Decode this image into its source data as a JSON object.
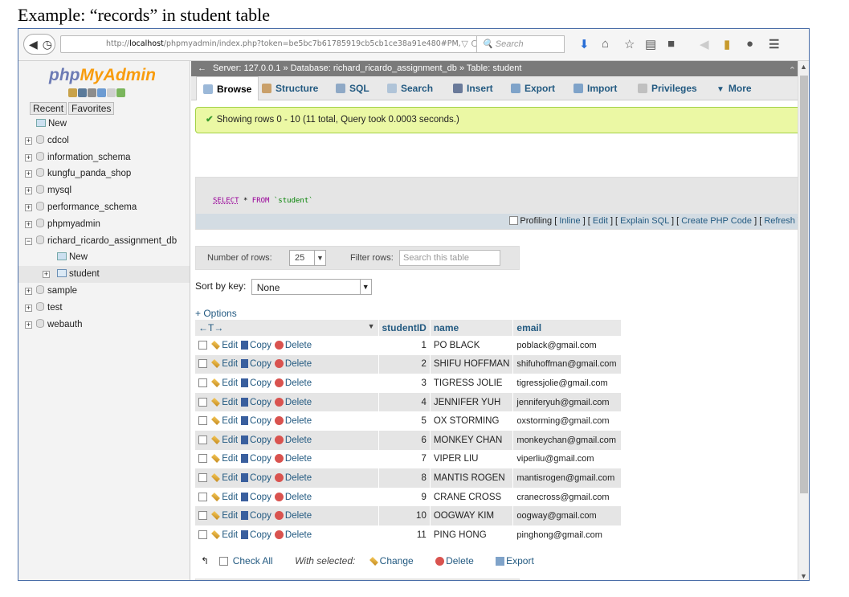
{
  "caption": "Example: “records” in student table",
  "browser": {
    "url_prefix": "http://",
    "url_host": "localhost",
    "url_rest": "/phpmyadmin/index.php?token=be5bc7b61785919cb5cb1ce38a91e480#PM,",
    "url_right": "▽ C",
    "search_placeholder": "Search"
  },
  "sidebar": {
    "logo_php": "php",
    "logo_my": "My",
    "logo_admin": "Admin",
    "tab_recent": "Recent",
    "tab_favorites": "Favorites",
    "tree": [
      {
        "label": "New",
        "type": "new"
      },
      {
        "label": "cdcol",
        "type": "db"
      },
      {
        "label": "information_schema",
        "type": "db"
      },
      {
        "label": "kungfu_panda_shop",
        "type": "db"
      },
      {
        "label": "mysql",
        "type": "db"
      },
      {
        "label": "performance_schema",
        "type": "db"
      },
      {
        "label": "phpmyadmin",
        "type": "db"
      },
      {
        "label": "richard_ricardo_assignment_db",
        "type": "db-open"
      },
      {
        "label": "New",
        "type": "child-new"
      },
      {
        "label": "student",
        "type": "child-table"
      },
      {
        "label": "sample",
        "type": "db"
      },
      {
        "label": "test",
        "type": "db"
      },
      {
        "label": "webauth",
        "type": "db"
      }
    ]
  },
  "server_bar": "Server: 127.0.0.1 » Database: richard_ricardo_assignment_db » Table: student",
  "tabs": [
    "Browse",
    "Structure",
    "SQL",
    "Search",
    "Insert",
    "Export",
    "Import",
    "Privileges",
    "More"
  ],
  "success_message": "Showing rows 0 - 10 (11 total, Query took 0.0003 seconds.)",
  "sql": {
    "select": "SELECT",
    "star": "*",
    "from": "FROM",
    "table": "`student`",
    "profiling": "Profiling",
    "links": [
      "Inline",
      "Edit",
      "Explain SQL",
      "Create PHP Code",
      "Refresh"
    ]
  },
  "nav": {
    "rows_label": "Number of rows:",
    "rows_value": "25",
    "filter_label": "Filter rows:",
    "filter_placeholder": "Search this table"
  },
  "sort": {
    "label": "Sort by key:",
    "value": "None"
  },
  "options_label": "+ Options",
  "table": {
    "headers": [
      "studentID",
      "name",
      "email"
    ],
    "actions": {
      "edit": "Edit",
      "copy": "Copy",
      "delete": "Delete"
    },
    "rows": [
      {
        "id": "1",
        "name": "PO BLACK",
        "email": "poblack@gmail.com"
      },
      {
        "id": "2",
        "name": "SHIFU HOFFMAN",
        "email": "shifuhoffman@gmail.com"
      },
      {
        "id": "3",
        "name": "TIGRESS JOLIE",
        "email": "tigressjolie@gmail.com"
      },
      {
        "id": "4",
        "name": "JENNIFER YUH",
        "email": "jenniferyuh@gmail.com"
      },
      {
        "id": "5",
        "name": "OX STORMING",
        "email": "oxstorming@gmail.com"
      },
      {
        "id": "6",
        "name": "MONKEY CHAN",
        "email": "monkeychan@gmail.com"
      },
      {
        "id": "7",
        "name": "VIPER LIU",
        "email": "viperliu@gmail.com"
      },
      {
        "id": "8",
        "name": "MANTIS ROGEN",
        "email": "mantisrogen@gmail.com"
      },
      {
        "id": "9",
        "name": "CRANE CROSS",
        "email": "cranecross@gmail.com"
      },
      {
        "id": "10",
        "name": "OOGWAY KIM",
        "email": "oogway@gmail.com"
      },
      {
        "id": "11",
        "name": "PING HONG",
        "email": "pinghong@gmail.com"
      }
    ]
  },
  "bottom": {
    "check_all": "Check All",
    "with_selected": "With selected:",
    "change": "Change",
    "delete": "Delete",
    "export": "Export"
  }
}
